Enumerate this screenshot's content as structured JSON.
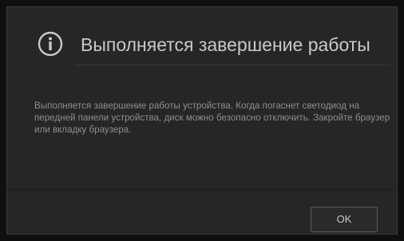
{
  "dialog": {
    "title": "Выполняется завершение работы",
    "message": "Выполняется завершение работы устройства. Когда погаснет светодиод на передней панели устройства, диск можно безопасно отключить. Закройте браузер или вкладку браузера.",
    "ok_label": "OK",
    "icon": "info-icon"
  },
  "colors": {
    "background": "#0f0f0f",
    "panel": "#262626",
    "title_text": "#c9c9c9",
    "body_text": "#8e8e8e",
    "button_border": "#5a5a5a"
  }
}
